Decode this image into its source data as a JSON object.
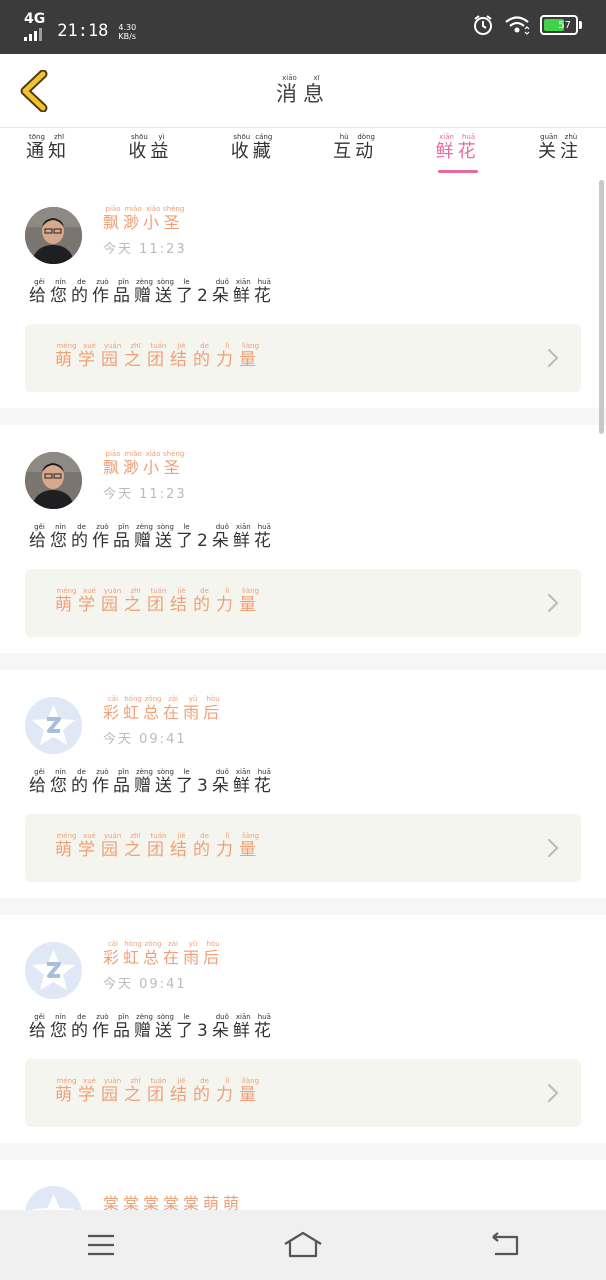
{
  "status_bar": {
    "network": "4G",
    "time": "21:18",
    "speed_value": "4.30",
    "speed_unit": "KB/s",
    "battery_level": "57"
  },
  "header": {
    "title": [
      {
        "char": "消",
        "pinyin": "xiāo"
      },
      {
        "char": "息",
        "pinyin": "xī"
      }
    ]
  },
  "tabs": [
    {
      "label": [
        {
          "char": "通",
          "pinyin": "tōng"
        },
        {
          "char": "知",
          "pinyin": "zhī"
        }
      ],
      "active": false
    },
    {
      "label": [
        {
          "char": "收",
          "pinyin": "shōu"
        },
        {
          "char": "益",
          "pinyin": "yì"
        }
      ],
      "active": false
    },
    {
      "label": [
        {
          "char": "收",
          "pinyin": "shōu"
        },
        {
          "char": "藏",
          "pinyin": "cáng"
        }
      ],
      "active": false
    },
    {
      "label": [
        {
          "char": "互",
          "pinyin": "hù"
        },
        {
          "char": "动",
          "pinyin": "dòng"
        }
      ],
      "active": false
    },
    {
      "label": [
        {
          "char": "鲜",
          "pinyin": "xiān"
        },
        {
          "char": "花",
          "pinyin": "huā"
        }
      ],
      "active": true
    },
    {
      "label": [
        {
          "char": "关",
          "pinyin": "guān"
        },
        {
          "char": "注",
          "pinyin": "zhù"
        }
      ],
      "active": false
    }
  ],
  "cards": [
    {
      "avatar": "user-photo",
      "username": [
        {
          "char": "飘",
          "pinyin": "piāo"
        },
        {
          "char": "渺",
          "pinyin": "miǎo"
        },
        {
          "char": "小",
          "pinyin": "xiǎo"
        },
        {
          "char": "圣",
          "pinyin": "shèng"
        }
      ],
      "time_word": "今天",
      "time": "11:23",
      "message": [
        {
          "char": "给",
          "pinyin": "gěi"
        },
        {
          "char": "您",
          "pinyin": "nín"
        },
        {
          "char": "的",
          "pinyin": "de"
        },
        {
          "char": "作",
          "pinyin": "zuò"
        },
        {
          "char": "品",
          "pinyin": "pǐn"
        },
        {
          "char": "赠",
          "pinyin": "zèng"
        },
        {
          "char": "送",
          "pinyin": "sòng"
        },
        {
          "char": "了",
          "pinyin": "le"
        },
        {
          "char": "2",
          "pinyin": ""
        },
        {
          "char": "朵",
          "pinyin": "duǒ"
        },
        {
          "char": "鲜",
          "pinyin": "xiān"
        },
        {
          "char": "花",
          "pinyin": "huā"
        }
      ],
      "work_title": [
        {
          "char": "萌",
          "pinyin": "méng"
        },
        {
          "char": "学",
          "pinyin": "xué"
        },
        {
          "char": "园",
          "pinyin": "yuán"
        },
        {
          "char": "之",
          "pinyin": "zhī"
        },
        {
          "char": "团",
          "pinyin": "tuán"
        },
        {
          "char": "结",
          "pinyin": "jié"
        },
        {
          "char": "的",
          "pinyin": "de"
        },
        {
          "char": "力",
          "pinyin": "lì"
        },
        {
          "char": "量",
          "pinyin": "liàng"
        }
      ]
    },
    {
      "avatar": "user-photo",
      "username": [
        {
          "char": "飘",
          "pinyin": "piāo"
        },
        {
          "char": "渺",
          "pinyin": "miǎo"
        },
        {
          "char": "小",
          "pinyin": "xiǎo"
        },
        {
          "char": "圣",
          "pinyin": "shèng"
        }
      ],
      "time_word": "今天",
      "time": "11:23",
      "message": [
        {
          "char": "给",
          "pinyin": "gěi"
        },
        {
          "char": "您",
          "pinyin": "nín"
        },
        {
          "char": "的",
          "pinyin": "de"
        },
        {
          "char": "作",
          "pinyin": "zuò"
        },
        {
          "char": "品",
          "pinyin": "pǐn"
        },
        {
          "char": "赠",
          "pinyin": "zèng"
        },
        {
          "char": "送",
          "pinyin": "sòng"
        },
        {
          "char": "了",
          "pinyin": "le"
        },
        {
          "char": "2",
          "pinyin": ""
        },
        {
          "char": "朵",
          "pinyin": "duǒ"
        },
        {
          "char": "鲜",
          "pinyin": "xiān"
        },
        {
          "char": "花",
          "pinyin": "huā"
        }
      ],
      "work_title": [
        {
          "char": "萌",
          "pinyin": "méng"
        },
        {
          "char": "学",
          "pinyin": "xué"
        },
        {
          "char": "园",
          "pinyin": "yuán"
        },
        {
          "char": "之",
          "pinyin": "zhī"
        },
        {
          "char": "团",
          "pinyin": "tuán"
        },
        {
          "char": "结",
          "pinyin": "jié"
        },
        {
          "char": "的",
          "pinyin": "de"
        },
        {
          "char": "力",
          "pinyin": "lì"
        },
        {
          "char": "量",
          "pinyin": "liàng"
        }
      ]
    },
    {
      "avatar": "qq-default",
      "username": [
        {
          "char": "彩",
          "pinyin": "cǎi"
        },
        {
          "char": "虹",
          "pinyin": "hóng"
        },
        {
          "char": "总",
          "pinyin": "zǒng"
        },
        {
          "char": "在",
          "pinyin": "zài"
        },
        {
          "char": "雨",
          "pinyin": "yǔ"
        },
        {
          "char": "后",
          "pinyin": "hòu"
        }
      ],
      "time_word": "今天",
      "time": "09:41",
      "message": [
        {
          "char": "给",
          "pinyin": "gěi"
        },
        {
          "char": "您",
          "pinyin": "nín"
        },
        {
          "char": "的",
          "pinyin": "de"
        },
        {
          "char": "作",
          "pinyin": "zuò"
        },
        {
          "char": "品",
          "pinyin": "pǐn"
        },
        {
          "char": "赠",
          "pinyin": "zèng"
        },
        {
          "char": "送",
          "pinyin": "sòng"
        },
        {
          "char": "了",
          "pinyin": "le"
        },
        {
          "char": "3",
          "pinyin": ""
        },
        {
          "char": "朵",
          "pinyin": "duǒ"
        },
        {
          "char": "鲜",
          "pinyin": "xiān"
        },
        {
          "char": "花",
          "pinyin": "huā"
        }
      ],
      "work_title": [
        {
          "char": "萌",
          "pinyin": "méng"
        },
        {
          "char": "学",
          "pinyin": "xué"
        },
        {
          "char": "园",
          "pinyin": "yuán"
        },
        {
          "char": "之",
          "pinyin": "zhī"
        },
        {
          "char": "团",
          "pinyin": "tuán"
        },
        {
          "char": "结",
          "pinyin": "jié"
        },
        {
          "char": "的",
          "pinyin": "de"
        },
        {
          "char": "力",
          "pinyin": "lì"
        },
        {
          "char": "量",
          "pinyin": "liàng"
        }
      ]
    },
    {
      "avatar": "qq-default",
      "username": [
        {
          "char": "彩",
          "pinyin": "cǎi"
        },
        {
          "char": "虹",
          "pinyin": "hóng"
        },
        {
          "char": "总",
          "pinyin": "zǒng"
        },
        {
          "char": "在",
          "pinyin": "zài"
        },
        {
          "char": "雨",
          "pinyin": "yǔ"
        },
        {
          "char": "后",
          "pinyin": "hòu"
        }
      ],
      "time_word": "今天",
      "time": "09:41",
      "message": [
        {
          "char": "给",
          "pinyin": "gěi"
        },
        {
          "char": "您",
          "pinyin": "nín"
        },
        {
          "char": "的",
          "pinyin": "de"
        },
        {
          "char": "作",
          "pinyin": "zuò"
        },
        {
          "char": "品",
          "pinyin": "pǐn"
        },
        {
          "char": "赠",
          "pinyin": "zèng"
        },
        {
          "char": "送",
          "pinyin": "sòng"
        },
        {
          "char": "了",
          "pinyin": "le"
        },
        {
          "char": "3",
          "pinyin": ""
        },
        {
          "char": "朵",
          "pinyin": "duǒ"
        },
        {
          "char": "鲜",
          "pinyin": "xiān"
        },
        {
          "char": "花",
          "pinyin": "huā"
        }
      ],
      "work_title": [
        {
          "char": "萌",
          "pinyin": "méng"
        },
        {
          "char": "学",
          "pinyin": "xué"
        },
        {
          "char": "园",
          "pinyin": "yuán"
        },
        {
          "char": "之",
          "pinyin": "zhī"
        },
        {
          "char": "团",
          "pinyin": "tuán"
        },
        {
          "char": "结",
          "pinyin": "jié"
        },
        {
          "char": "的",
          "pinyin": "de"
        },
        {
          "char": "力",
          "pinyin": "lì"
        },
        {
          "char": "量",
          "pinyin": "liàng"
        }
      ]
    }
  ],
  "partial_card": {
    "avatar": "qq-default",
    "username": "棠棠棠棠棠萌萌"
  },
  "colors": {
    "accent_pink": "#e96a9c",
    "name_orange": "#f0a077",
    "back_arrow": "#f2c230",
    "battery_green": "#3fd24a"
  },
  "nav_bar": [
    "menu-icon",
    "home-icon",
    "back-icon"
  ]
}
